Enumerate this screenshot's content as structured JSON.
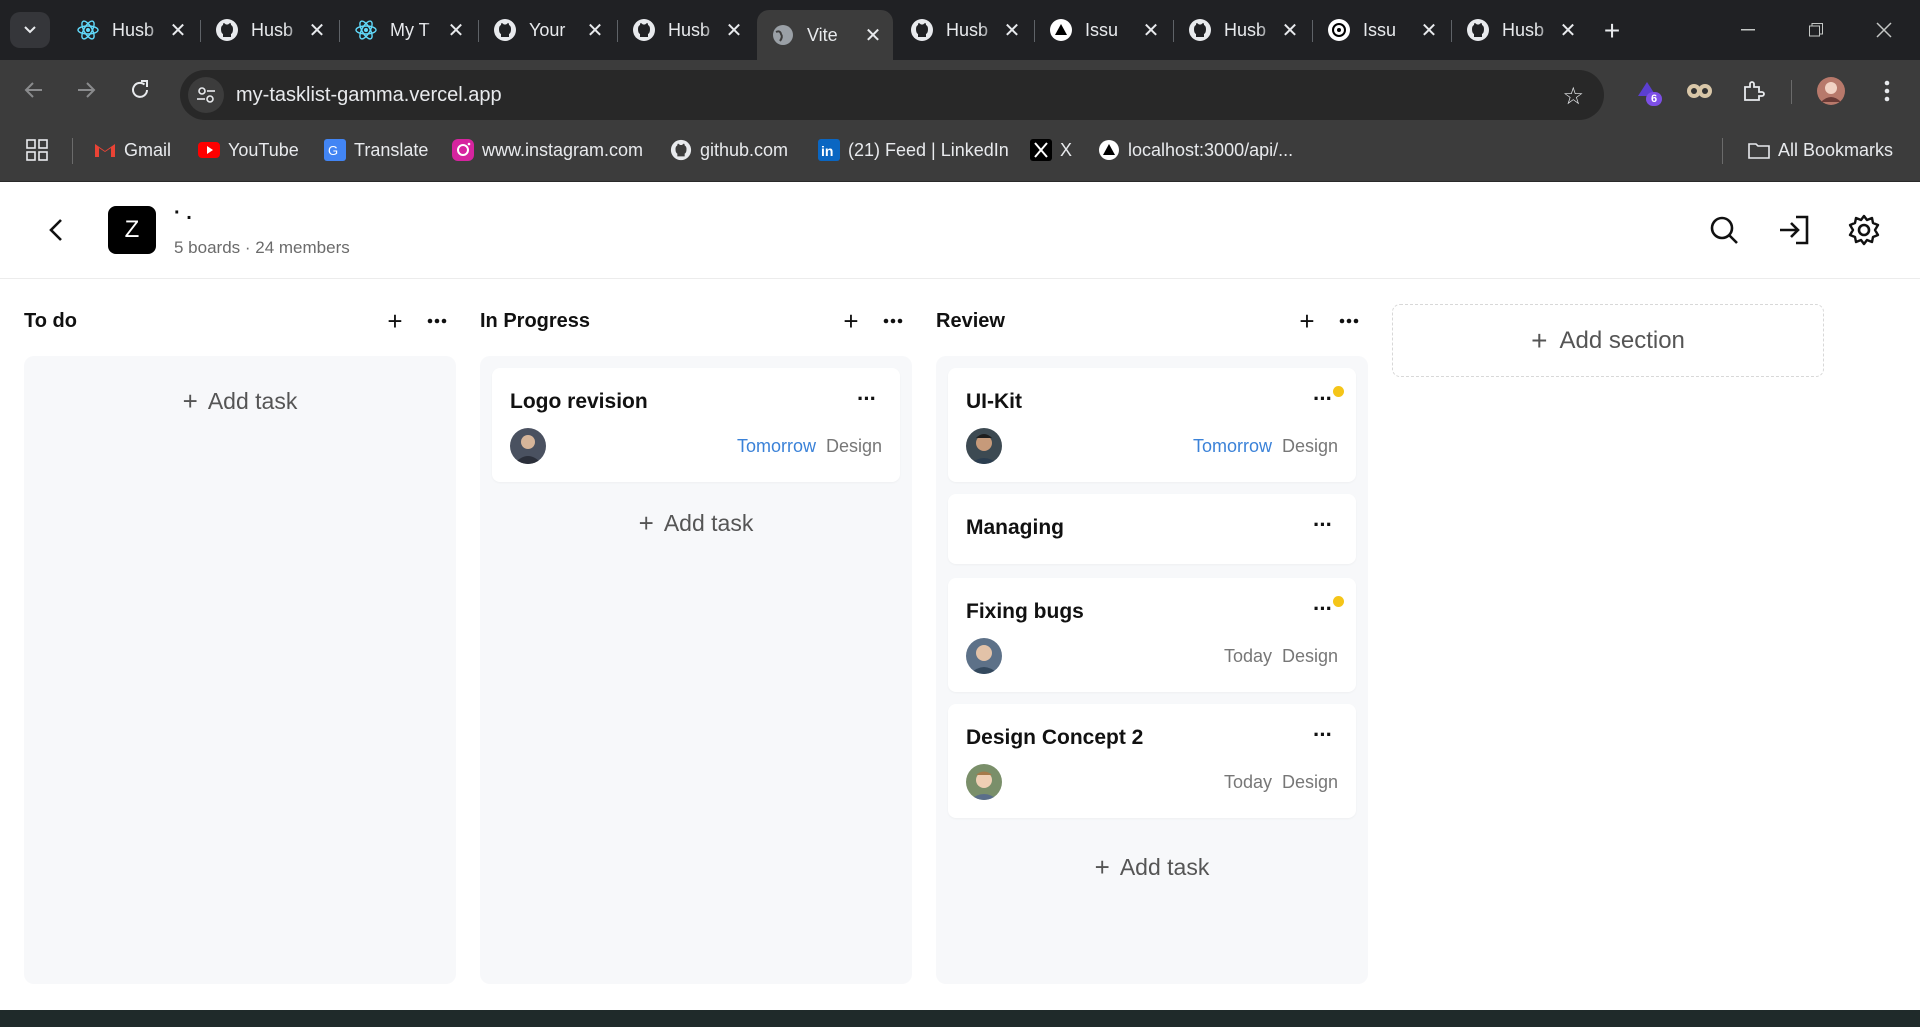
{
  "browser": {
    "tabs": [
      {
        "title": "Husb",
        "icon": "react-icon",
        "color": "#61dafb"
      },
      {
        "title": "Husb",
        "icon": "github-icon",
        "color": "#e8eaed"
      },
      {
        "title": "My T",
        "icon": "react-icon",
        "color": "#61dafb"
      },
      {
        "title": "Your",
        "icon": "github-icon",
        "color": "#e8eaed"
      },
      {
        "title": "Husb",
        "icon": "github-icon",
        "color": "#e8eaed"
      },
      {
        "title": "Vite",
        "icon": "globe-icon",
        "color": "#9aa0a6",
        "active": true
      },
      {
        "title": "Husb",
        "icon": "github-icon",
        "color": "#e8eaed"
      },
      {
        "title": "Issu",
        "icon": "vercel-icon",
        "color": "#ffffff"
      },
      {
        "title": "Husb",
        "icon": "github-icon",
        "color": "#e8eaed"
      },
      {
        "title": "Issu",
        "icon": "openai-icon",
        "color": "#ffffff"
      },
      {
        "title": "Husb",
        "icon": "github-icon",
        "color": "#e8eaed"
      }
    ],
    "url": "my-tasklist-gamma.vercel.app",
    "extension_badge": "6",
    "bookmarks": [
      {
        "label": "Gmail",
        "icon": "gmail-icon"
      },
      {
        "label": "YouTube",
        "icon": "youtube-icon"
      },
      {
        "label": "Translate",
        "icon": "translate-icon"
      },
      {
        "label": "www.instagram.com",
        "icon": "instagram-icon"
      },
      {
        "label": "github.com",
        "icon": "github-icon"
      },
      {
        "label": "(21) Feed | LinkedIn",
        "icon": "linkedin-icon"
      },
      {
        "label": "X",
        "icon": "x-icon"
      },
      {
        "label": "localhost:3000/api/...",
        "icon": "vercel-icon"
      }
    ],
    "all_bookmarks": "All Bookmarks"
  },
  "workspace": {
    "logo_letter": "Z",
    "name": "·      .",
    "meta": "5 boards · 24 members"
  },
  "columns": [
    {
      "title": "To do",
      "cards": [],
      "add_task": "Add task"
    },
    {
      "title": "In Progress",
      "add_task": "Add task",
      "cards": [
        {
          "title": "Logo revision",
          "due": "Tomorrow",
          "due_style": "blue",
          "tag": "Design",
          "dot": false
        }
      ]
    },
    {
      "title": "Review",
      "add_task": "Add task",
      "cards": [
        {
          "title": "UI-Kit",
          "due": "Tomorrow",
          "due_style": "blue",
          "tag": "Design",
          "dot": true
        },
        {
          "title": "Managing",
          "dot": false
        },
        {
          "title": "Fixing bugs",
          "due": "Today",
          "due_style": "grey",
          "tag": "Design",
          "dot": true
        },
        {
          "title": "Design Concept 2",
          "due": "Today",
          "due_style": "grey",
          "tag": "Design",
          "dot": false
        }
      ]
    }
  ],
  "add_section": "Add section",
  "colors": {
    "accent_blue": "#3b82d8",
    "notify_dot": "#f5c518",
    "column_bg": "#f7f8fa"
  }
}
